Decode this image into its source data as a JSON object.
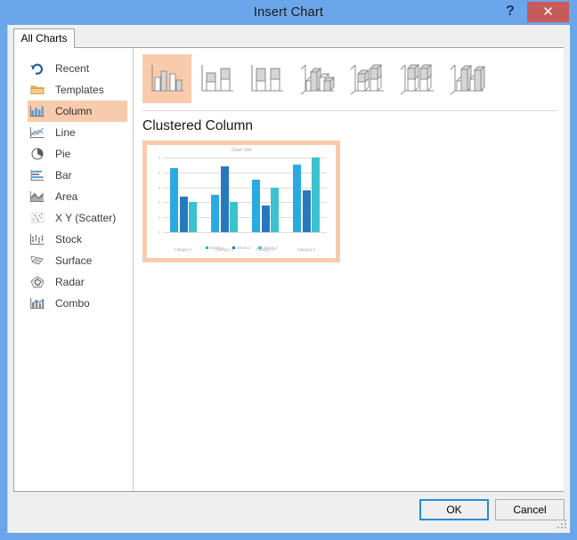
{
  "window": {
    "title": "Insert Chart",
    "help_label": "?",
    "close_label": "✕",
    "titlebar_color": "#6CA6EA",
    "close_color": "#C75B5B"
  },
  "tabs": [
    {
      "label": "All Charts",
      "active": true
    }
  ],
  "sidebar": {
    "items": [
      {
        "label": "Recent",
        "icon": "recent-icon",
        "selected": false
      },
      {
        "label": "Templates",
        "icon": "folder-icon",
        "selected": false
      },
      {
        "label": "Column",
        "icon": "column-icon",
        "selected": true
      },
      {
        "label": "Line",
        "icon": "line-icon",
        "selected": false
      },
      {
        "label": "Pie",
        "icon": "pie-icon",
        "selected": false
      },
      {
        "label": "Bar",
        "icon": "bar-icon",
        "selected": false
      },
      {
        "label": "Area",
        "icon": "area-icon",
        "selected": false
      },
      {
        "label": "X Y (Scatter)",
        "icon": "scatter-icon",
        "selected": false
      },
      {
        "label": "Stock",
        "icon": "stock-icon",
        "selected": false
      },
      {
        "label": "Surface",
        "icon": "surface-icon",
        "selected": false
      },
      {
        "label": "Radar",
        "icon": "radar-icon",
        "selected": false
      },
      {
        "label": "Combo",
        "icon": "combo-icon",
        "selected": false
      }
    ],
    "selection_color": "#F9CBAD"
  },
  "chart_types": [
    {
      "name": "Clustered Column",
      "icon": "clustered-column-icon",
      "selected": true
    },
    {
      "name": "Stacked Column",
      "icon": "stacked-column-icon",
      "selected": false
    },
    {
      "name": "100% Stacked Column",
      "icon": "100-stacked-column-icon",
      "selected": false
    },
    {
      "name": "3-D Clustered Column",
      "icon": "3d-clustered-column-icon",
      "selected": false
    },
    {
      "name": "3-D Stacked Column",
      "icon": "3d-stacked-column-icon",
      "selected": false
    },
    {
      "name": "3-D 100% Stacked Column",
      "icon": "3d-100-stacked-column-icon",
      "selected": false
    },
    {
      "name": "3-D Column",
      "icon": "3d-column-icon",
      "selected": false
    }
  ],
  "preview": {
    "title": "Clustered Column",
    "frame_color": "#F9CBAD"
  },
  "chart_data": {
    "type": "bar",
    "title": "Chart Title",
    "xlabel": "",
    "ylabel": "",
    "ylim": [
      0,
      5
    ],
    "yticks": [
      0,
      1,
      2,
      3,
      4,
      5
    ],
    "ytick_labels": [
      "0",
      "1",
      "2",
      "3",
      "4",
      "5"
    ],
    "grid": true,
    "legend_position": "bottom",
    "categories": [
      "Category 1",
      "Category 2",
      "Category 3",
      "Category 4"
    ],
    "series": [
      {
        "name": "Series 1",
        "color": "#29ABE2",
        "values": [
          4.3,
          2.5,
          3.5,
          4.5
        ]
      },
      {
        "name": "Series 2",
        "color": "#2878BE",
        "values": [
          2.4,
          4.4,
          1.8,
          2.8
        ]
      },
      {
        "name": "Series 3",
        "color": "#3BC2CE",
        "values": [
          2.0,
          2.0,
          3.0,
          5.0
        ]
      }
    ]
  },
  "footer": {
    "ok_label": "OK",
    "cancel_label": "Cancel"
  }
}
